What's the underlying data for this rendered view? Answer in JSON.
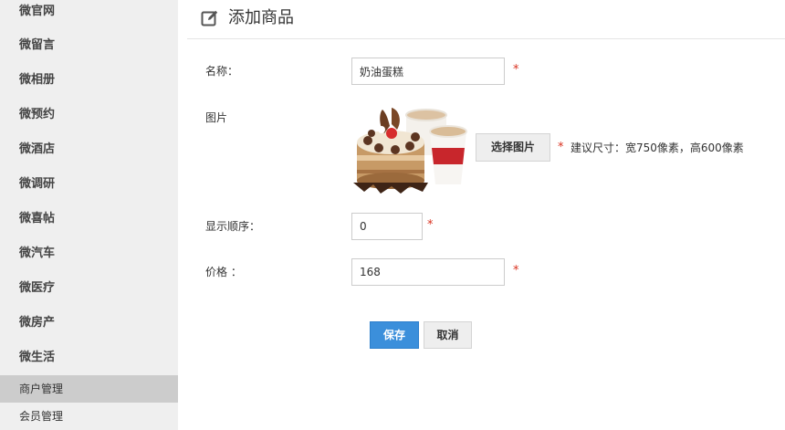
{
  "sidebar": {
    "items": [
      {
        "label": "微官网"
      },
      {
        "label": "微留言"
      },
      {
        "label": "微相册"
      },
      {
        "label": "微预约"
      },
      {
        "label": "微酒店"
      },
      {
        "label": "微调研"
      },
      {
        "label": "微喜帖"
      },
      {
        "label": "微汽车"
      },
      {
        "label": "微医疗"
      },
      {
        "label": "微房产"
      },
      {
        "label": "微生活"
      }
    ],
    "sub_items": [
      {
        "label": "商户管理",
        "active": true
      },
      {
        "label": "会员管理",
        "active": false
      }
    ]
  },
  "header": {
    "title": "添加商品",
    "icon": "edit-icon"
  },
  "form": {
    "name": {
      "label": "名称：",
      "value": "奶油蛋糕",
      "required_mark": "*"
    },
    "image": {
      "label": "图片",
      "thumbnail": "cake-and-coffee-photo",
      "button_label": "选择图片",
      "required_mark": "*",
      "hint": "建议尺寸：宽750像素，高600像素"
    },
    "order": {
      "label": "显示顺序：",
      "value": "0",
      "required_mark": "*"
    },
    "price": {
      "label": "价格 ：",
      "value": "168",
      "required_mark": "*"
    }
  },
  "actions": {
    "save_label": "保存",
    "cancel_label": "取消"
  },
  "colors": {
    "sidebar_bg": "#efefef",
    "sidebar_active_bg": "#cccccc",
    "primary": "#3b8fdb",
    "required": "#d9311f"
  }
}
